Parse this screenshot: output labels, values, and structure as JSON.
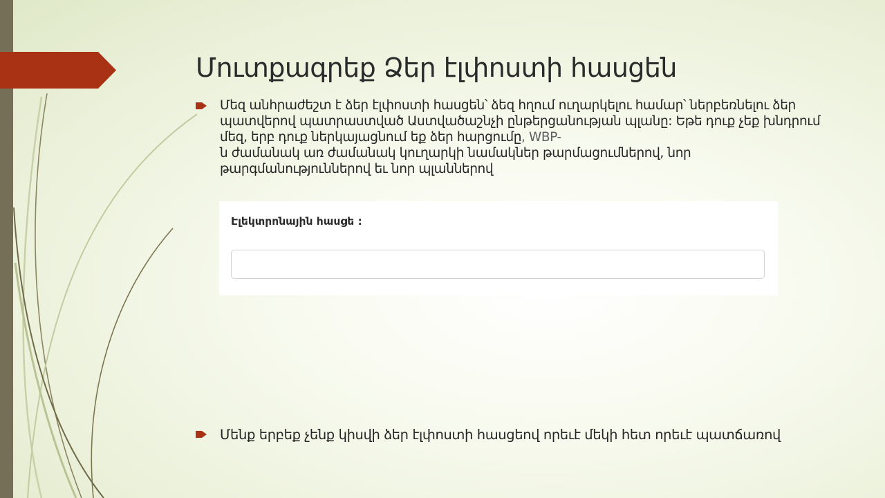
{
  "slide": {
    "title": "Մուտքագրեք Ձեր էլփոստի հասցեն",
    "bullets": [
      {
        "text_main": "Մեզ անհրաժեշտ է ձեր էլփոստի հասցեն՝ ձեզ հղում ուղարկելու համար՝ ներբեռնելու ձեր պատվերով պատրաստված Աստվածաշնչի ընթերցանության պլանը:  Եթե դուք չեք խնդրում մեզ, երբ դուք ներկայացնում եք ձեր հարցումը",
        "text_suffix": ", WBP-",
        "text_tail": "ն ժամանակ առ ժամանակ կուղարկի նամակներ թարմացումներով, նոր թարգմանություններով եւ նոր պլաններով"
      },
      {
        "text": "Մենք երբեք չենք կիսվի ձեր էլփոստի հասցեով որեւէ մեկի հետ որեւէ պատճառով"
      }
    ],
    "form": {
      "email_label": "Էլեկտրոնային հասցե :",
      "email_value": "",
      "email_placeholder": ""
    }
  },
  "colors": {
    "accent_tab": "#a83213",
    "left_bar": "#756f57",
    "bullet_marker": "#a83213"
  },
  "icons": {
    "bullet_marker": "arrow-bullet-icon"
  }
}
